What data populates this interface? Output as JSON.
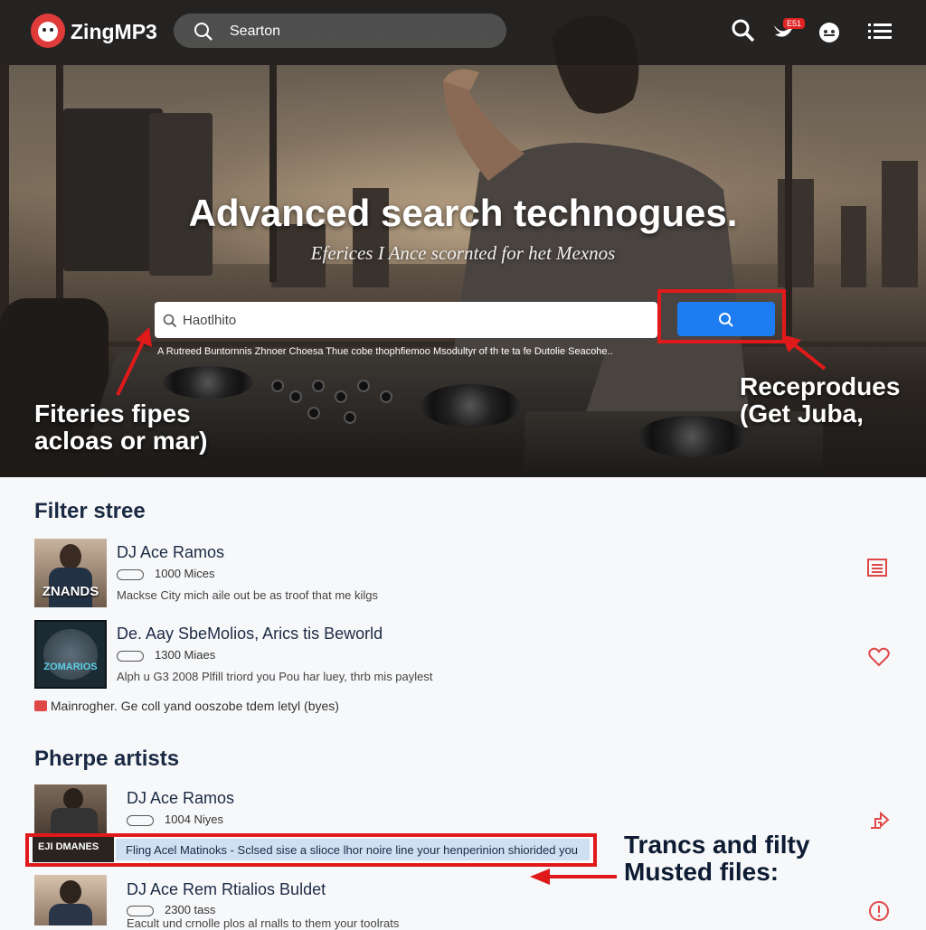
{
  "app": {
    "name": "ZingMP3"
  },
  "topbar": {
    "search_placeholder": "Searton",
    "notification_badge": "E51",
    "icons": [
      "search-icon",
      "bird-notification-icon",
      "account-icon",
      "menu-icon"
    ]
  },
  "hero": {
    "title": "Advanced search technogues.",
    "subtitle": "Eferices I Ance scornted for het Mexnos",
    "search_placeholder": "Haotlhito",
    "note": "A Rutreed Buntornnis Zhnoer Choesa Thue cobe thophfiemoo Msodultyr of th te ta fe Dutolie Seacohe.."
  },
  "annotations": {
    "left": [
      "Fiteries fipes",
      "acloas or mar)"
    ],
    "right": [
      "Receprodues",
      "(Get Juba,"
    ],
    "bottom": [
      "Trancs and filty",
      "Musted files:"
    ]
  },
  "filter_section": {
    "title": "Filter stree",
    "items": [
      {
        "title": "DJ Ace Ramos",
        "meta": "1000 Mices",
        "desc": "Mackse City mich aile out be as troof that me kilgs",
        "thumb_text": "ZNANDS",
        "action_icon": "list-icon"
      },
      {
        "title": "De. Aay SbeMolios, Arics tis Beworld",
        "meta": "1300 Miaes",
        "desc": "Alph u G3 2008 Plfill triord you Pou har luey, thrb mis paylest",
        "thumb_text": "ZOMARIOS",
        "action_icon": "heart-icon"
      }
    ],
    "footer_note": "Mainrogher. Ge coll yand ooszobe tdem letyl (byes)"
  },
  "artists_section": {
    "title": "Pherpe artists",
    "items": [
      {
        "title": "DJ Ace Ramos",
        "meta": "1004 Niyes",
        "thumb_text": "EJI DMANES",
        "action_icon": "share-icon"
      },
      {
        "title": "DJ Ace Rem Rtialios Buldet",
        "meta": "2300 tass",
        "desc": "Eacult und crnolle plos al rnalls to them your toolrats",
        "action_icon": "info-icon"
      }
    ],
    "highlight_text": "Fling Acel Matinoks - Sclsed sise a slioce lhor noire line your henperinion shiorided you"
  },
  "colors": {
    "accent_red": "#e01a1a",
    "button_blue": "#1d7cf2",
    "title_navy": "#1b2a44"
  }
}
